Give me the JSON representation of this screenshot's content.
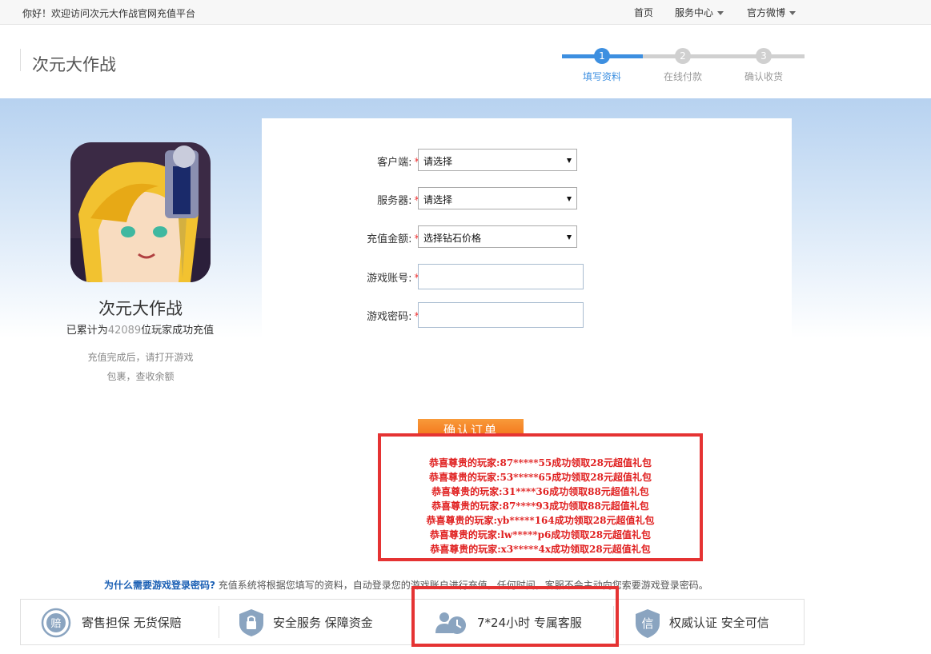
{
  "topbar": {
    "welcome": "你好！欢迎访问次元大作战官网充值平台",
    "nav_home": "首页",
    "nav_service": "服务中心",
    "nav_weibo": "官方微博"
  },
  "header": {
    "brand": "次元大作战",
    "steps": [
      {
        "num": "1",
        "label": "填写资料"
      },
      {
        "num": "2",
        "label": "在线付款"
      },
      {
        "num": "3",
        "label": "确认收货"
      }
    ]
  },
  "game": {
    "name": "次元大作战",
    "stats_prefix": "已累计为",
    "stats_count": "42089",
    "stats_suffix": "位玩家成功充值",
    "tip_line1": "充值完成后，请打开游戏",
    "tip_line2": "包裹，查收余额"
  },
  "form": {
    "client_label": "客户端:",
    "client_value": "请选择",
    "server_label": "服务器:",
    "server_value": "请选择",
    "amount_label": "充值金额:",
    "amount_value": "选择钻石价格",
    "account_label": "游戏账号:",
    "password_label": "游戏密码:",
    "required_mark": "*",
    "confirm_label": "确认订单"
  },
  "notices": [
    "恭喜尊贵的玩家:87*****55成功领取28元超值礼包",
    "恭喜尊贵的玩家:53*****65成功领取28元超值礼包",
    "恭喜尊贵的玩家:31****36成功领取88元超值礼包",
    "恭喜尊贵的玩家:87****93成功领取88元超值礼包",
    "恭喜尊贵的玩家:yb*****164成功领取28元超值礼包",
    "恭喜尊贵的玩家:lw*****p6成功领取28元超值礼包",
    "恭喜尊贵的玩家:x3*****4x成功领取28元超值礼包"
  ],
  "explain": {
    "question": "为什么需要游戏登录密码?",
    "text": "充值系统将根据您填写的资料，自动登录您的游戏账户进行充值，任何时间，客服不会主动向您索要游戏登录密码。"
  },
  "guarantees": [
    {
      "icon": "compensation-icon",
      "text": "寄售担保   无货保赔"
    },
    {
      "icon": "lock-shield-icon",
      "text": "安全服务   保障资金"
    },
    {
      "icon": "customer-service-icon",
      "text": "7*24小时   专属客服"
    },
    {
      "icon": "trust-badge-icon",
      "text": "权威认证   安全可信"
    }
  ],
  "icon_glyphs": {
    "compensation": "赔",
    "trust": "信"
  },
  "colors": {
    "accent_blue": "#3d8fe0",
    "step_inactive": "#cccccc",
    "highlight_red": "#e53333",
    "confirm_orange": "#f26b12"
  }
}
